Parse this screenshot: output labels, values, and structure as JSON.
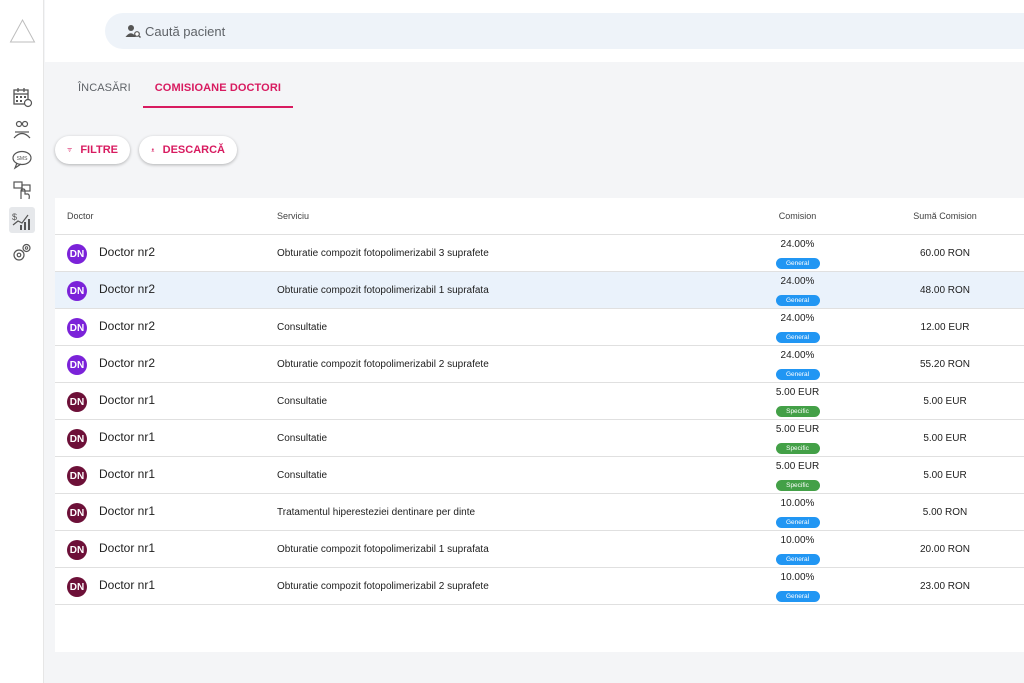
{
  "colors": {
    "accent": "#d81b60",
    "general_badge": "#2196f3",
    "specific_badge": "#43a047",
    "avatar_nr2": "#7b22d9",
    "avatar_nr1": "#6d1038",
    "selected_row": "#eaf2fb"
  },
  "search": {
    "placeholder": "Caută pacient",
    "icon": "user-search-icon"
  },
  "sidebar": {
    "icons": [
      "calendar-icon",
      "patients-icon",
      "sms-icon",
      "touch-hand-icon",
      "commission-chart-icon",
      "settings-gear-icon"
    ],
    "active": "commission-chart-icon"
  },
  "tabs": [
    {
      "label": "Încasări",
      "active": false
    },
    {
      "label": "Comisioane doctori",
      "active": true
    }
  ],
  "toolbar": {
    "filter_label": "Filtre",
    "download_label": "Descarcă"
  },
  "table": {
    "headers": {
      "doctor": "Doctor",
      "service": "Serviciu",
      "commission": "Comision",
      "sum": "Sumă Comision"
    },
    "rows": [
      {
        "initials": "DN",
        "doctor": "Doctor nr2",
        "service": "Obturatie compozit fotopolimerizabil 3 suprafete",
        "commission": "24.00%",
        "badge": "General",
        "sum": "60.00 RON",
        "selected": false
      },
      {
        "initials": "DN",
        "doctor": "Doctor nr2",
        "service": "Obturatie compozit fotopolimerizabil 1 suprafata",
        "commission": "24.00%",
        "badge": "General",
        "sum": "48.00 RON",
        "selected": true
      },
      {
        "initials": "DN",
        "doctor": "Doctor nr2",
        "service": "Consultatie",
        "commission": "24.00%",
        "badge": "General",
        "sum": "12.00 EUR",
        "selected": false
      },
      {
        "initials": "DN",
        "doctor": "Doctor nr2",
        "service": "Obturatie compozit fotopolimerizabil 2 suprafete",
        "commission": "24.00%",
        "badge": "General",
        "sum": "55.20 RON",
        "selected": false
      },
      {
        "initials": "DN",
        "doctor": "Doctor nr1",
        "service": "Consultatie",
        "commission": "5.00 EUR",
        "badge": "Specific",
        "sum": "5.00 EUR",
        "selected": false
      },
      {
        "initials": "DN",
        "doctor": "Doctor nr1",
        "service": "Consultatie",
        "commission": "5.00 EUR",
        "badge": "Specific",
        "sum": "5.00 EUR",
        "selected": false
      },
      {
        "initials": "DN",
        "doctor": "Doctor nr1",
        "service": "Consultatie",
        "commission": "5.00 EUR",
        "badge": "Specific",
        "sum": "5.00 EUR",
        "selected": false
      },
      {
        "initials": "DN",
        "doctor": "Doctor nr1",
        "service": "Tratamentul hiperesteziei dentinare per dinte",
        "commission": "10.00%",
        "badge": "General",
        "sum": "5.00 RON",
        "selected": false
      },
      {
        "initials": "DN",
        "doctor": "Doctor nr1",
        "service": "Obturatie compozit fotopolimerizabil 1 suprafata",
        "commission": "10.00%",
        "badge": "General",
        "sum": "20.00 RON",
        "selected": false
      },
      {
        "initials": "DN",
        "doctor": "Doctor nr1",
        "service": "Obturatie compozit fotopolimerizabil 2 suprafete",
        "commission": "10.00%",
        "badge": "General",
        "sum": "23.00 RON",
        "selected": false
      }
    ]
  }
}
